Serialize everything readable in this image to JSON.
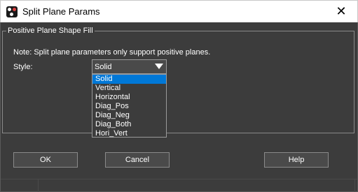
{
  "window": {
    "title": "Split Plane Params",
    "close_glyph": "✕"
  },
  "group": {
    "legend": "Positive Plane Shape Fill",
    "note": "Note: Split plane parameters only support positive planes.",
    "style_label": "Style:"
  },
  "style_select": {
    "value": "Solid",
    "options": [
      "Solid",
      "Vertical",
      "Horizontal",
      "Diag_Pos",
      "Diag_Neg",
      "Diag_Both",
      "Hori_Vert"
    ],
    "highlighted": "Solid"
  },
  "buttons": {
    "ok": "OK",
    "cancel": "Cancel",
    "help": "Help"
  },
  "colors": {
    "background": "#3c3c3c",
    "highlight": "#0078d7",
    "titlebar": "#ffffff"
  }
}
